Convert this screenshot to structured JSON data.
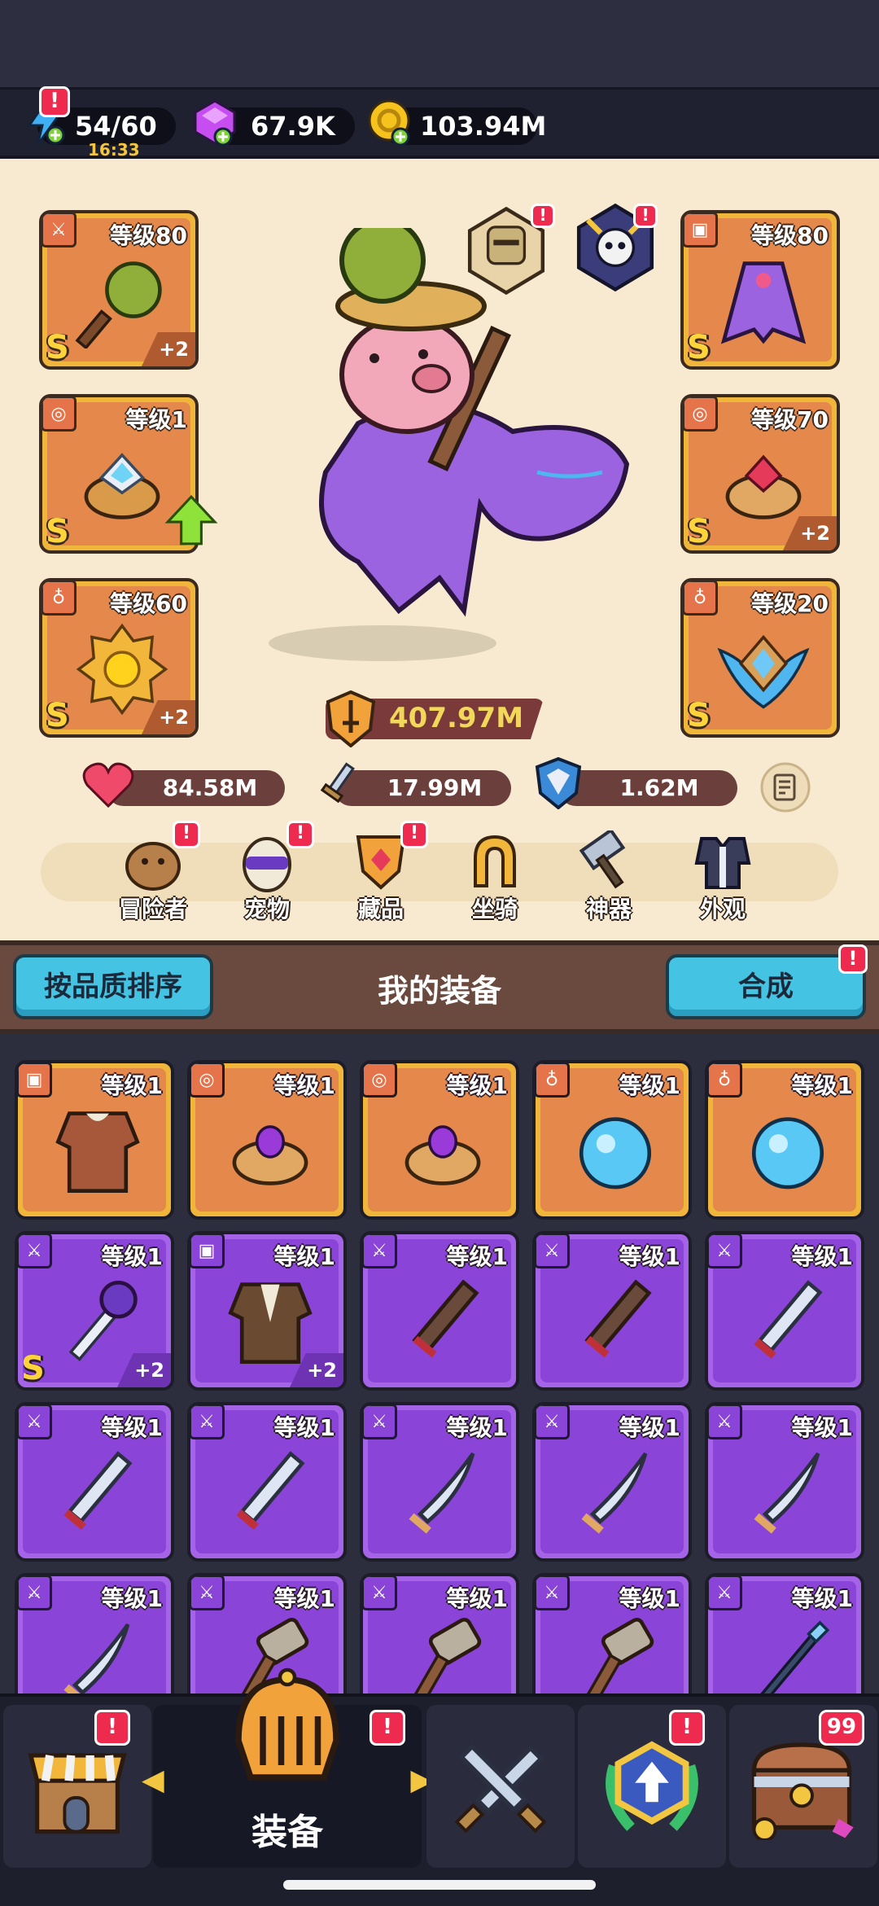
{
  "resources": {
    "energy": "54/60",
    "energy_timer": "16:33",
    "gems": "67.9K",
    "coins": "103.94M",
    "energy_alert": "!"
  },
  "hero": {
    "power": "407.97M",
    "stats": {
      "hp": "84.58M",
      "attack": "17.99M",
      "defense": "1.62M"
    },
    "left_slots": [
      {
        "level": "等级80",
        "grade": "S",
        "plus": "+2"
      },
      {
        "level": "等级1",
        "grade": "S",
        "plus": ""
      },
      {
        "level": "等级60",
        "grade": "S",
        "plus": "+2"
      }
    ],
    "right_slots": [
      {
        "level": "等级80",
        "grade": "S",
        "plus": ""
      },
      {
        "level": "等级70",
        "grade": "S",
        "plus": "+2"
      },
      {
        "level": "等级20",
        "grade": "S",
        "plus": ""
      }
    ],
    "companion_alerts": [
      "!",
      "!"
    ]
  },
  "menu": [
    {
      "label": "冒险者",
      "alert": "!"
    },
    {
      "label": "宠物",
      "alert": "!"
    },
    {
      "label": "藏品",
      "alert": "!"
    },
    {
      "label": "坐骑",
      "alert": ""
    },
    {
      "label": "神器",
      "alert": ""
    },
    {
      "label": "外观",
      "alert": ""
    }
  ],
  "bag": {
    "sort_label": "按品质排序",
    "title": "我的装备",
    "merge_label": "合成",
    "merge_alert": "!",
    "items": [
      {
        "level": "等级1",
        "plus": "",
        "grade": ""
      },
      {
        "level": "等级1",
        "plus": "",
        "grade": ""
      },
      {
        "level": "等级1",
        "plus": "",
        "grade": ""
      },
      {
        "level": "等级1",
        "plus": "",
        "grade": ""
      },
      {
        "level": "等级1",
        "plus": "",
        "grade": ""
      },
      {
        "level": "等级1",
        "plus": "+2",
        "grade": "S"
      },
      {
        "level": "等级1",
        "plus": "+2",
        "grade": ""
      },
      {
        "level": "等级1",
        "plus": "",
        "grade": ""
      },
      {
        "level": "等级1",
        "plus": "",
        "grade": ""
      },
      {
        "level": "等级1",
        "plus": "",
        "grade": ""
      },
      {
        "level": "等级1",
        "plus": "",
        "grade": ""
      },
      {
        "level": "等级1",
        "plus": "",
        "grade": ""
      },
      {
        "level": "等级1",
        "plus": "",
        "grade": ""
      },
      {
        "level": "等级1",
        "plus": "",
        "grade": ""
      },
      {
        "level": "等级1",
        "plus": "",
        "grade": ""
      },
      {
        "level": "等级1",
        "plus": "",
        "grade": ""
      },
      {
        "level": "等级1",
        "plus": "",
        "grade": ""
      },
      {
        "level": "等级1",
        "plus": "",
        "grade": ""
      },
      {
        "level": "等级1",
        "plus": "",
        "grade": ""
      },
      {
        "level": "等级1",
        "plus": "",
        "grade": ""
      }
    ]
  },
  "nav": {
    "active_label": "装备",
    "shop_alert": "!",
    "equip_alert": "!",
    "upgrade_alert": "!",
    "chest_count": "99"
  }
}
